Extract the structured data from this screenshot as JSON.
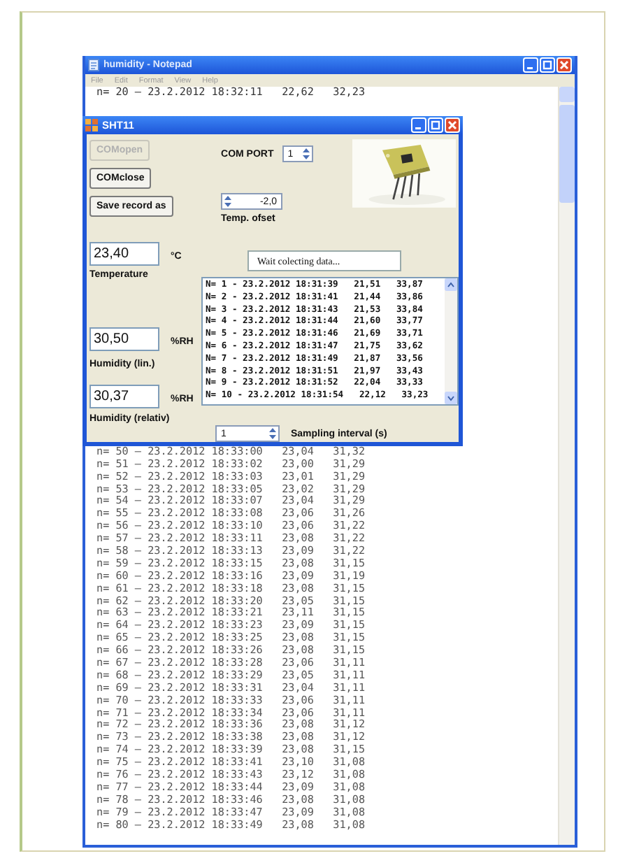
{
  "notepad": {
    "title": "humidity - Notepad",
    "menu": [
      "File",
      "Edit",
      "Format",
      "View",
      "Help"
    ],
    "lines": [
      "n= 20 – 23.2.2012 18:32:11   22,62   32,23"
    ],
    "lines_below_dialog": [
      "n= 50 – 23.2.2012 18:33:00   23,04   31,32",
      "n= 51 – 23.2.2012 18:33:02   23,00   31,29",
      "n= 52 – 23.2.2012 18:33:03   23,01   31,29",
      "n= 53 – 23.2.2012 18:33:05   23,02   31,29",
      "n= 54 – 23.2.2012 18:33:07   23,04   31,29",
      "n= 55 – 23.2.2012 18:33:08   23,06   31,26",
      "n= 56 – 23.2.2012 18:33:10   23,06   31,22",
      "n= 57 – 23.2.2012 18:33:11   23,08   31,22",
      "n= 58 – 23.2.2012 18:33:13   23,09   31,22",
      "n= 59 – 23.2.2012 18:33:15   23,08   31,15",
      "n= 60 – 23.2.2012 18:33:16   23,09   31,19",
      "n= 61 – 23.2.2012 18:33:18   23,08   31,15",
      "n= 62 – 23.2.2012 18:33:20   23,05   31,15",
      "n= 63 – 23.2.2012 18:33:21   23,11   31,15",
      "n= 64 – 23.2.2012 18:33:23   23,09   31,15",
      "n= 65 – 23.2.2012 18:33:25   23,08   31,15",
      "n= 66 – 23.2.2012 18:33:26   23,08   31,15",
      "n= 67 – 23.2.2012 18:33:28   23,06   31,11",
      "n= 68 – 23.2.2012 18:33:29   23,05   31,11",
      "n= 69 – 23.2.2012 18:33:31   23,04   31,11",
      "n= 70 – 23.2.2012 18:33:33   23,06   31,11",
      "n= 71 – 23.2.2012 18:33:34   23,06   31,11",
      "n= 72 – 23.2.2012 18:33:36   23,08   31,12",
      "n= 73 – 23.2.2012 18:33:38   23,08   31,12",
      "n= 74 – 23.2.2012 18:33:39   23,08   31,15",
      "n= 75 – 23.2.2012 18:33:41   23,10   31,08",
      "n= 76 – 23.2.2012 18:33:43   23,12   31,08",
      "n= 77 – 23.2.2012 18:33:44   23,09   31,08",
      "n= 78 – 23.2.2012 18:33:46   23,08   31,08",
      "n= 79 – 23.2.2012 18:33:47   23,09   31,08",
      "n= 80 – 23.2.2012 18:33:49   23,08   31,08"
    ]
  },
  "dialog": {
    "title": "SHT11",
    "buttons": [
      {
        "label": "COMopen",
        "disabled": true
      },
      {
        "label": "COMclose",
        "disabled": false
      },
      {
        "label": "Save record as",
        "disabled": false
      }
    ],
    "com_port": {
      "label": "COM PORT",
      "value": "1"
    },
    "temp_offset": {
      "value": "-2,0",
      "label": "Temp. ofset"
    },
    "temperature": {
      "value": "23,40",
      "unit": "°C",
      "label": "Temperature"
    },
    "status": "Wait colecting data...",
    "records": [
      "N= 1 - 23.2.2012 18:31:39   21,51   33,87",
      "N= 2 - 23.2.2012 18:31:41   21,44   33,86",
      "N= 3 - 23.2.2012 18:31:43   21,53   33,84",
      "N= 4 - 23.2.2012 18:31:44   21,60   33,77",
      "N= 5 - 23.2.2012 18:31:46   21,69   33,71",
      "N= 6 - 23.2.2012 18:31:47   21,75   33,62",
      "N= 7 - 23.2.2012 18:31:49   21,87   33,56",
      "N= 8 - 23.2.2012 18:31:51   21,97   33,43",
      "N= 9 - 23.2.2012 18:31:52   22,04   33,33",
      "N= 10 - 23.2.2012 18:31:54   22,12   33,23"
    ],
    "humidity_lin": {
      "value": "30,50",
      "unit": "%RH",
      "label": "Humidity (lin.)"
    },
    "humidity_rel": {
      "value": "30,37",
      "unit": "%RH",
      "label": "Humidity (relativ)"
    },
    "sampling": {
      "value": "1",
      "label": "Sampling interval (s)"
    }
  }
}
